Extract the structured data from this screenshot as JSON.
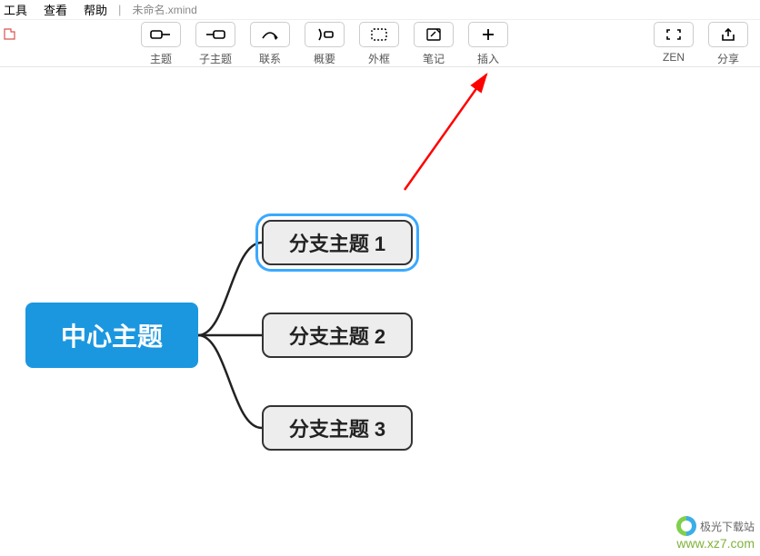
{
  "menu": {
    "tools": "工具",
    "view": "查看",
    "help": "帮助",
    "filename": "未命名.xmind"
  },
  "toolbar": {
    "topic": "主题",
    "subtopic": "子主题",
    "relation": "联系",
    "summary": "概要",
    "boundary": "外框",
    "note": "笔记",
    "insert": "插入",
    "zen": "ZEN",
    "share": "分享"
  },
  "mindmap": {
    "central": "中心主题",
    "branch1": "分支主题 1",
    "branch2": "分支主题 2",
    "branch3": "分支主题 3"
  },
  "watermark": {
    "name": "极光下载站",
    "url": "www.xz7.com"
  },
  "icons": {
    "topic": "topic-icon",
    "subtopic": "subtopic-icon",
    "relation": "relation-icon",
    "summary": "summary-icon",
    "boundary": "boundary-icon",
    "note": "note-icon",
    "insert": "plus-icon",
    "zen": "expand-icon",
    "share": "share-icon"
  },
  "colors": {
    "central_bg": "#1b97e0",
    "branch_bg": "#ededed",
    "branch_border": "#333333",
    "selection": "#3ba9ff",
    "arrow": "#ff0000"
  }
}
